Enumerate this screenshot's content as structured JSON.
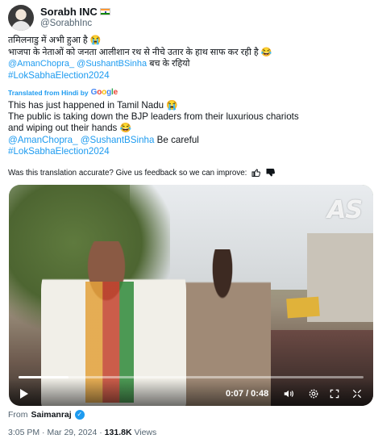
{
  "author": {
    "name": "Sorabh INC",
    "handle": "@SorabhInc",
    "flag_icon": "india-flag-icon"
  },
  "tweet": {
    "hindi_line1": "तमिलनाडु में अभी हुआ है 😭",
    "hindi_line2": "भाजपा के नेताओं को जनता आलीशान रथ से नीचे उतार के हाथ साफ कर रही है 😂",
    "mentions": "@AmanChopra_ @SushantBSinha",
    "hindi_mention_suffix": " बच के रहियो",
    "hashtag": "#LokSabhaElection2024",
    "translated_label": "Translated from Hindi by",
    "translation_provider": "Google",
    "english_line1": "This has just happened in Tamil Nadu 😭",
    "english_line2": "The public is taking down the BJP leaders from their luxurious chariots",
    "english_line3": "and wiping out their hands 😂",
    "english_mention_suffix": " Be careful",
    "feedback": "Was this translation accurate? Give us feedback so we can improve:"
  },
  "video": {
    "watermark": "AS",
    "time": "0:07 / 0:48",
    "progress": 0.146
  },
  "source": {
    "label": "From",
    "name": "Saimanraj"
  },
  "meta": {
    "time": "3:05 PM",
    "sep1": " · ",
    "date": "Mar 29, 2024",
    "sep2": " · ",
    "views_count": "131.8K",
    "views_label": " Views"
  }
}
